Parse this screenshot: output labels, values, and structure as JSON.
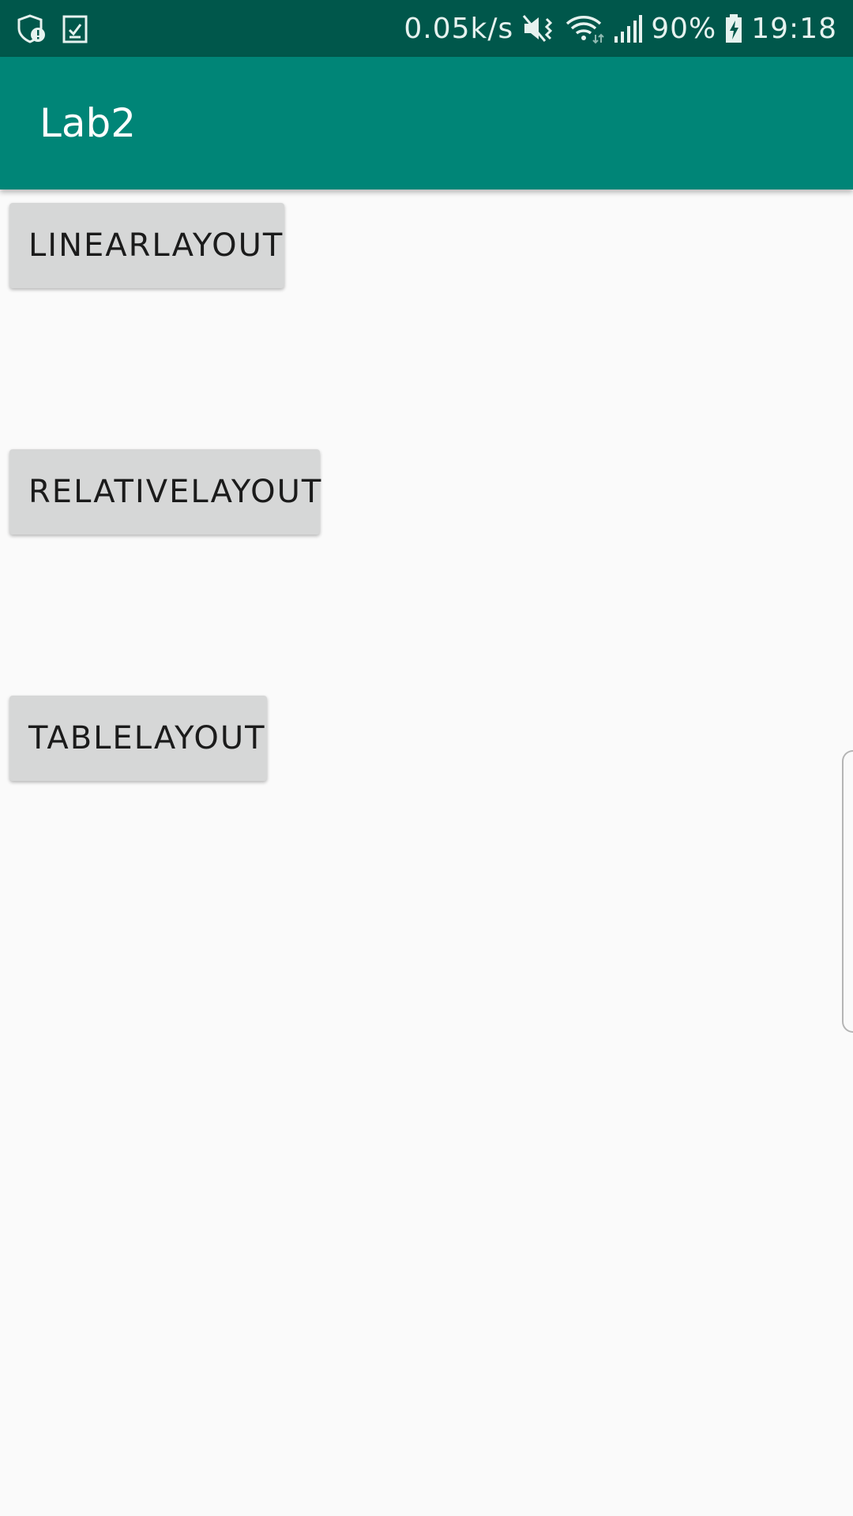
{
  "status_bar": {
    "net_speed": "0.05k/s",
    "battery": "90%",
    "time": "19:18",
    "icons": [
      "shield-alert-icon",
      "clipboard-check-icon",
      "mute-vibrate-icon",
      "wifi-icon",
      "signal-icon",
      "battery-charging-icon"
    ]
  },
  "app_bar": {
    "title": "Lab2"
  },
  "buttons": {
    "linear": "LINEARLAYOUT",
    "relative": "RELATIVELAYOUT",
    "table": "TABLELAYOUT"
  },
  "colors": {
    "status_bar": "#00574b",
    "app_bar": "#008577",
    "background": "#fafafa",
    "button": "#d6d7d7"
  }
}
